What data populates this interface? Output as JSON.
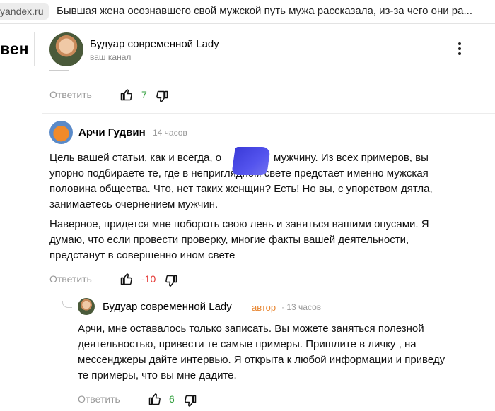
{
  "browser": {
    "url_fragment": "yandex.ru",
    "tab_title": "Бывшая жена осознавшего свой мужской путь мужа рассказала, из-за чего они ра..."
  },
  "left_cut_text": "вен",
  "channel": {
    "name": "Будуар современной Lady",
    "subtitle": "ваш канал"
  },
  "post_actions": {
    "reply_label": "Ответить",
    "likes": "7"
  },
  "comments": [
    {
      "author": "Арчи Гудвин",
      "time": "14 часов",
      "paragraphs": [
        [
          "Цель вашей статьи, как и всегда, о",
          "мужчину. Из всех примеров, вы",
          "упорно подбираете те, где в неприглядном свете предстает именно мужская",
          "половина общества. Что, нет таких женщин? Есть! Но вы, с упорством дятла,",
          "занимаетесь очернением мужчин."
        ],
        [
          "Наверное, придется мне побороть свою лень и заняться вашими опусами. Я",
          "думаю, что если провести проверку, многие факты вашей деятельности,",
          "предстанут в совершенно ином свете"
        ]
      ],
      "reply_label": "Ответить",
      "score": "-10",
      "score_color": "#e53935"
    }
  ],
  "reply": {
    "author": "Будуар современной Lady",
    "badge": "автор",
    "time": "· 13 часов",
    "lines": [
      "Арчи, мне оставалось только записать. Вы можете заняться полезной",
      "деятельностью, привести те самые примеры. Пришлите в личку , на",
      "мессенджеры дайте интервью. Я открыта к любой информации и приведу",
      "те примеры, что вы мне дадите."
    ],
    "reply_label": "Ответить",
    "likes": "6",
    "likes_color": "#2e9e3a"
  },
  "colors": {
    "positive": "#2e9e3a",
    "negative": "#e53935",
    "author_badge": "#e8852f",
    "muted": "#999999"
  },
  "icons": [
    "thumbs-up-icon",
    "thumbs-down-icon",
    "more-vertical-icon"
  ]
}
